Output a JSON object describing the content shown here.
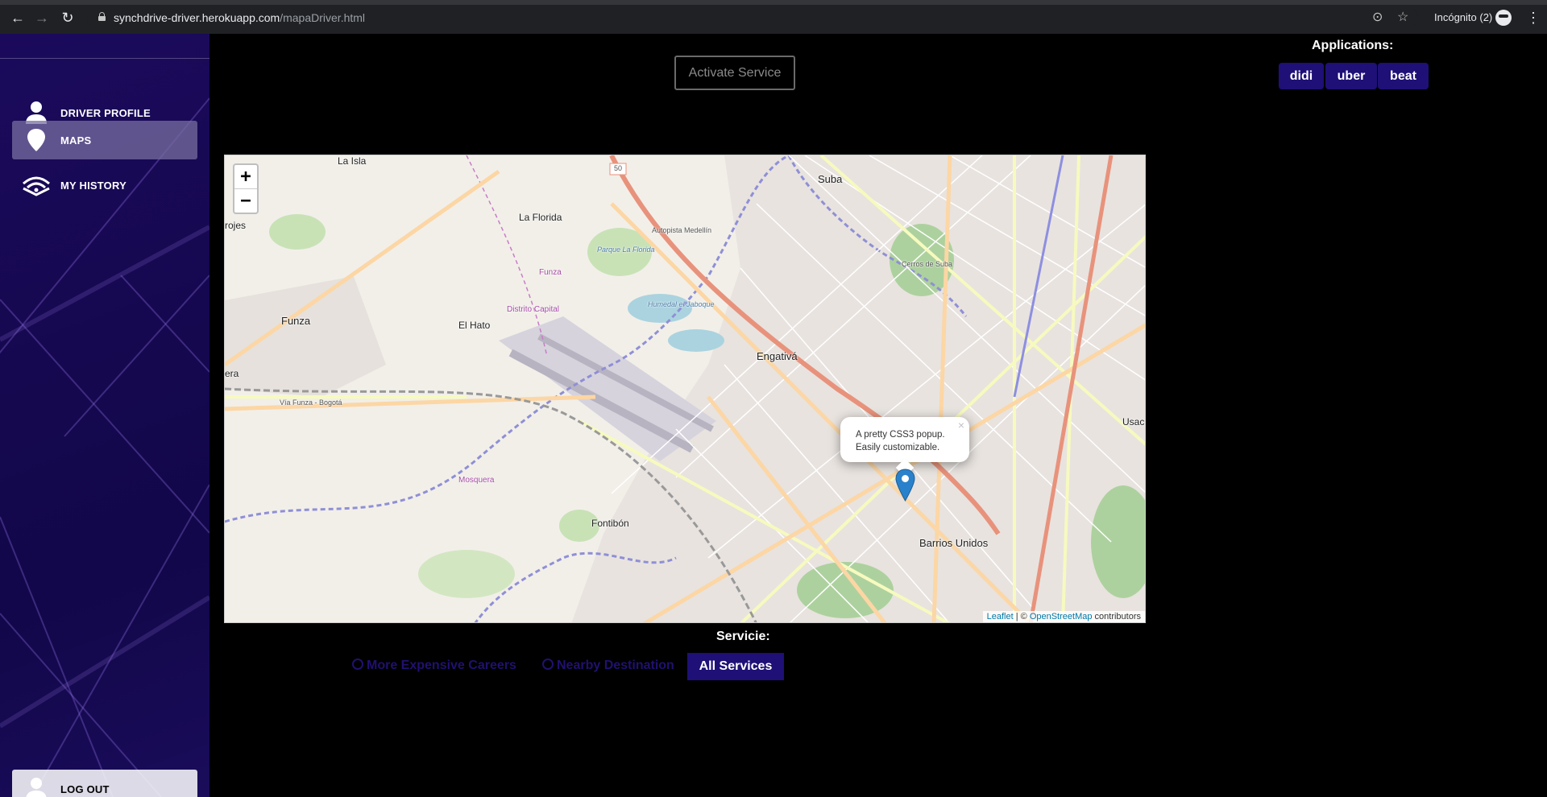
{
  "browser": {
    "url_host": "synchdrive-driver.herokuapp.com",
    "url_path": "/mapaDriver.html",
    "profile_label": "Incógnito (2)"
  },
  "sidebar": {
    "items": [
      {
        "label": "DRIVER PROFILE",
        "icon": "person-icon",
        "active": false
      },
      {
        "label": "MAPS",
        "icon": "map-pin-icon",
        "active": true
      },
      {
        "label": "MY HISTORY",
        "icon": "wifi-history-icon",
        "active": false
      }
    ],
    "logout_label": "LOG OUT"
  },
  "header": {
    "activate_label": "Activate Service",
    "applications_title": "Applications:",
    "apps": [
      "didi",
      "uber",
      "beat"
    ]
  },
  "map": {
    "zoom_in": "+",
    "zoom_out": "−",
    "popup_text": "A pretty CSS3 popup. Easily customizable.",
    "popup_close": "×",
    "attribution_leaflet": "Leaflet",
    "attribution_sep": " | © ",
    "attribution_osm": "OpenStreetMap",
    "attribution_suffix": " contributors",
    "labels": {
      "la_isla": "La Isla",
      "rojes": "rojes",
      "la_florida": "La Florida",
      "suba": "Suba",
      "funza": "Funza",
      "el_hato": "El Hato",
      "engativa": "Engativá",
      "fontibon": "Fontibón",
      "barrios_unidos": "Barrios Unidos",
      "usac": "Usac",
      "era": "era",
      "cerros": "Cerros de Suba",
      "humedal": "Humedal el Jaboque",
      "parque": "Parque La Florida",
      "distrito": "Distrito Capital",
      "mosquera": "Mosquera",
      "funza_river": "Funza",
      "route_50": "50",
      "autopista": "Autopista Medellín",
      "via_funza": "Vía Funza - Bogotá"
    }
  },
  "filter": {
    "title": "Servicie:",
    "options": [
      "More Expensive Careers",
      "Nearby Destination"
    ],
    "all_label": "All Services"
  }
}
